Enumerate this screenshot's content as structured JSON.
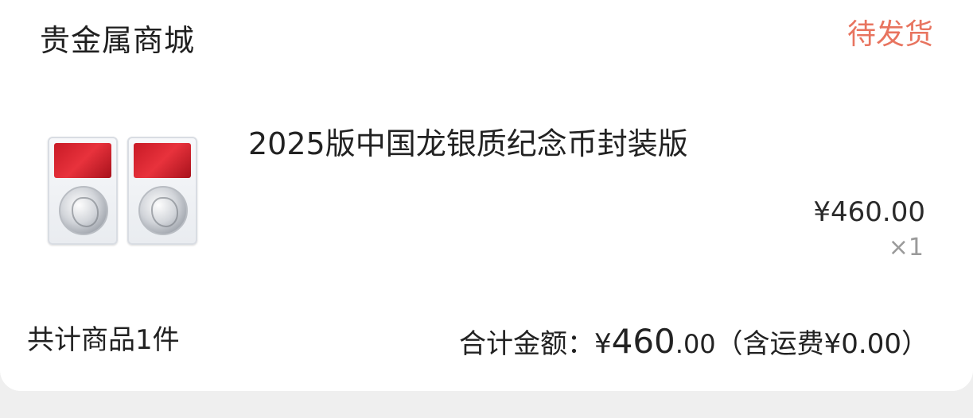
{
  "order": {
    "shop_name": "贵金属商城",
    "status": "待发货"
  },
  "product": {
    "title": "2025版中国龙银质纪念币封装版",
    "price": "¥460.00",
    "quantity": "×1"
  },
  "summary": {
    "item_count": "共计商品1件",
    "total_label": "合计金额：¥",
    "total_int": "460",
    "total_dec": ".00",
    "shipping": "（含运费¥0.00）"
  },
  "colors": {
    "status": "#e8745f",
    "label_red": "#c81a26"
  }
}
